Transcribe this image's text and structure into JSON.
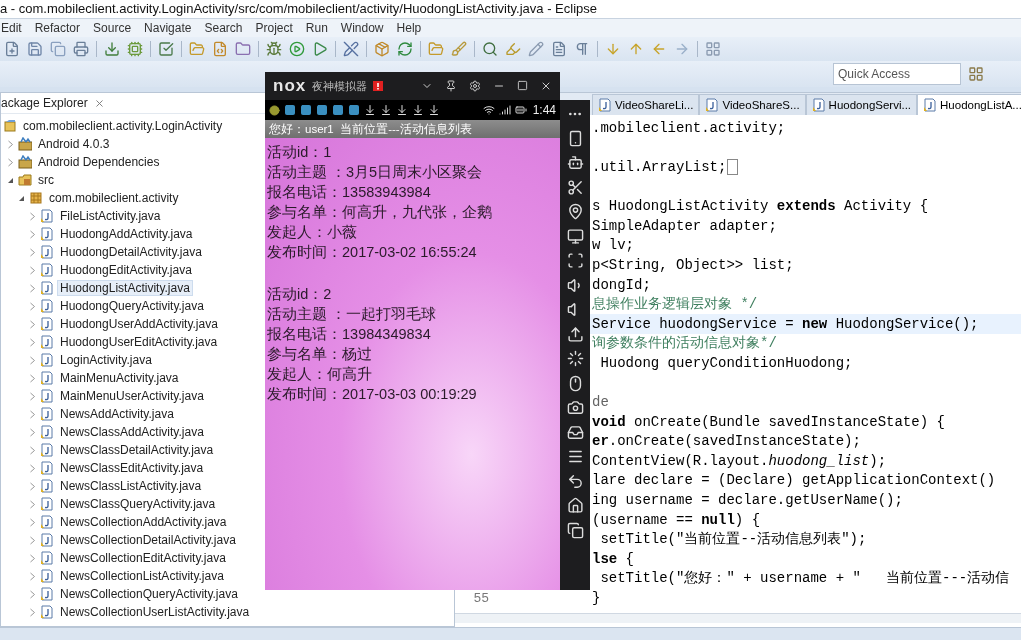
{
  "window": {
    "title": "a - com.mobileclient.activity.LoginActivity/src/com/mobileclient/activity/HuodongListActivity.java - Eclipse"
  },
  "menu": [
    "Edit",
    "Refactor",
    "Source",
    "Navigate",
    "Search",
    "Project",
    "Run",
    "Window",
    "Help"
  ],
  "quick_access": {
    "placeholder": "Quick Access"
  },
  "explorer": {
    "title": "ackage Explorer",
    "tree": [
      {
        "label": "com.mobileclient.activity.LoginActivity",
        "kind": "project",
        "selected": false,
        "children": [
          {
            "label": "Android 4.0.3",
            "kind": "library",
            "expanded": false,
            "selected": false
          },
          {
            "label": "Android Dependencies",
            "kind": "library",
            "expanded": false,
            "selected": false
          },
          {
            "label": "src",
            "kind": "folder",
            "expanded": true,
            "selected": false,
            "children": [
              {
                "label": "com.mobileclient.activity",
                "kind": "package",
                "expanded": true,
                "selected": false,
                "children": [
                  {
                    "label": "FileListActivity.java",
                    "kind": "file",
                    "expanded": false,
                    "selected": false
                  },
                  {
                    "label": "HuodongAddActivity.java",
                    "kind": "file",
                    "expanded": false,
                    "selected": false
                  },
                  {
                    "label": "HuodongDetailActivity.java",
                    "kind": "file",
                    "expanded": false,
                    "selected": false
                  },
                  {
                    "label": "HuodongEditActivity.java",
                    "kind": "file",
                    "expanded": false,
                    "selected": false
                  },
                  {
                    "label": "HuodongListActivity.java",
                    "kind": "file",
                    "expanded": false,
                    "selected": true
                  },
                  {
                    "label": "HuodongQueryActivity.java",
                    "kind": "file",
                    "expanded": false,
                    "selected": false
                  },
                  {
                    "label": "HuodongUserAddActivity.java",
                    "kind": "file",
                    "expanded": false,
                    "selected": false
                  },
                  {
                    "label": "HuodongUserEditActivity.java",
                    "kind": "file",
                    "expanded": false,
                    "selected": false
                  },
                  {
                    "label": "LoginActivity.java",
                    "kind": "file",
                    "expanded": false,
                    "selected": false
                  },
                  {
                    "label": "MainMenuActivity.java",
                    "kind": "file",
                    "expanded": false,
                    "selected": false
                  },
                  {
                    "label": "MainMenuUserActivity.java",
                    "kind": "file",
                    "expanded": false,
                    "selected": false
                  },
                  {
                    "label": "NewsAddActivity.java",
                    "kind": "file",
                    "expanded": false,
                    "selected": false
                  },
                  {
                    "label": "NewsClassAddActivity.java",
                    "kind": "file",
                    "expanded": false,
                    "selected": false
                  },
                  {
                    "label": "NewsClassDetailActivity.java",
                    "kind": "file",
                    "expanded": false,
                    "selected": false
                  },
                  {
                    "label": "NewsClassEditActivity.java",
                    "kind": "file",
                    "expanded": false,
                    "selected": false
                  },
                  {
                    "label": "NewsClassListActivity.java",
                    "kind": "file",
                    "expanded": false,
                    "selected": false
                  },
                  {
                    "label": "NewsClassQueryActivity.java",
                    "kind": "file",
                    "expanded": false,
                    "selected": false
                  },
                  {
                    "label": "NewsCollectionAddActivity.java",
                    "kind": "file",
                    "expanded": false,
                    "selected": false
                  },
                  {
                    "label": "NewsCollectionDetailActivity.java",
                    "kind": "file",
                    "expanded": false,
                    "selected": false
                  },
                  {
                    "label": "NewsCollectionEditActivity.java",
                    "kind": "file",
                    "expanded": false,
                    "selected": false
                  },
                  {
                    "label": "NewsCollectionListActivity.java",
                    "kind": "file",
                    "expanded": false,
                    "selected": false
                  },
                  {
                    "label": "NewsCollectionQueryActivity.java",
                    "kind": "file",
                    "expanded": false,
                    "selected": false
                  },
                  {
                    "label": "NewsCollectionUserListActivity.java",
                    "kind": "file",
                    "expanded": false,
                    "selected": false
                  }
                ]
              }
            ]
          }
        ]
      }
    ]
  },
  "editor": {
    "tabs": [
      {
        "label": "VideoShareLi...",
        "selected": false
      },
      {
        "label": "VideoShareS...",
        "selected": false
      },
      {
        "label": "HuodongServi...",
        "selected": false
      },
      {
        "label": "HuodongListA...",
        "selected": true
      }
    ],
    "lines": [
      {
        "kind": "code",
        "text": ".mobileclient.activity;",
        "current": false
      },
      {
        "kind": "blank",
        "current": false
      },
      {
        "kind": "code",
        "text": ".util.ArrayList;",
        "current": false,
        "folded": true
      },
      {
        "kind": "blank",
        "current": false
      },
      {
        "kind": "code",
        "text": "s HuodongListActivity **extends** Activity {",
        "current": false
      },
      {
        "kind": "code",
        "text": "SimpleAdapter adapter;",
        "current": false
      },
      {
        "kind": "code",
        "text": "w lv;",
        "current": false
      },
      {
        "kind": "code",
        "text": "p<String, Object>> list;",
        "current": false
      },
      {
        "kind": "code",
        "text": "dongId;",
        "current": false
      },
      {
        "kind": "comment",
        "text": "息操作业务逻辑层对象 */",
        "current": false
      },
      {
        "kind": "code",
        "text": "Service huodongService = **new** HuodongService();",
        "current": true
      },
      {
        "kind": "comment",
        "text": "询参数条件的活动信息对象*/",
        "current": false
      },
      {
        "kind": "code",
        "text": " Huodong queryConditionHuodong;",
        "current": false
      },
      {
        "kind": "blank",
        "current": false
      },
      {
        "kind": "annotation",
        "text": "de",
        "current": false
      },
      {
        "kind": "code",
        "text": "**void** onCreate(Bundle savedInstanceState) {",
        "current": false
      },
      {
        "kind": "code",
        "text": "**er**.onCreate(savedInstanceState);",
        "current": false
      },
      {
        "kind": "code",
        "text": "ContentView(R.layout.*huodong_list*);",
        "current": false
      },
      {
        "kind": "code",
        "text": "lare declare = (Declare) getApplicationContext()",
        "current": false
      },
      {
        "kind": "code",
        "text": "ing username = declare.getUserName();",
        "current": false
      },
      {
        "kind": "code",
        "text": "(username == **null**) {",
        "current": false
      },
      {
        "kind": "code",
        "text": " setTitle(\"当前位置--活动信息列表\");",
        "current": false
      },
      {
        "kind": "code",
        "text": "**lse** {",
        "current": false
      },
      {
        "kind": "code",
        "text": " setTitle(\"您好：\" + username + \"   当前位置---活动信",
        "current": false
      },
      {
        "kind": "code",
        "text": "}",
        "current": false,
        "line_number": "55"
      }
    ]
  },
  "emulator": {
    "logo": "nox",
    "title": "夜神模拟器",
    "time": "1:44",
    "app_title": "您好：user1  当前位置---活动信息列表",
    "records": [
      {
        "lines": [
          "活动id：1",
          "活动主题 ：3月5日周末小区聚会",
          "报名电话：13583943984",
          "参与名单：何高升，九代张，企鹅",
          "发起人：小薇",
          "发布时间：2017-03-02 16:55:24"
        ]
      },
      {
        "lines": [
          "活动id：2",
          "活动主题 ：一起打羽毛球",
          "报名电话：13984349834",
          "参与名单：杨过",
          "发起人：何高升",
          "发布时间：2017-03-03 00:19:29"
        ]
      }
    ]
  }
}
